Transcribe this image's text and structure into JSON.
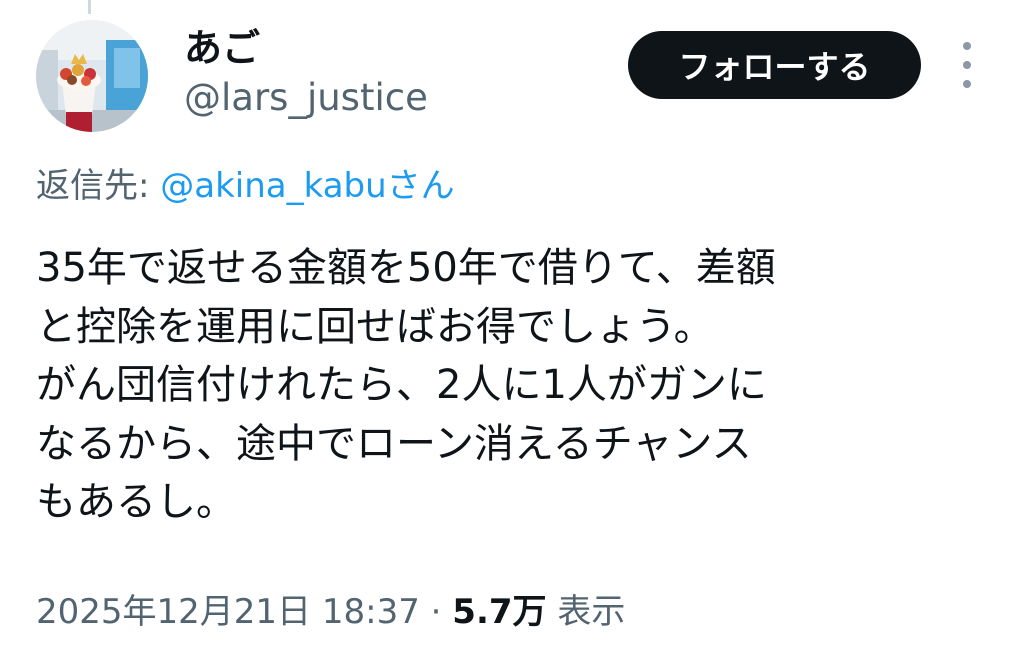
{
  "user": {
    "display_name": "あご",
    "handle": "@lars_justice"
  },
  "follow_button": {
    "label": "フォローする"
  },
  "more_menu": {
    "icon": "more-vertical-icon"
  },
  "reply": {
    "prefix": "返信先: ",
    "mention": "@akina_kabuさん"
  },
  "tweet": {
    "lines": [
      "35年で返せる金額を50年で借りて、差額",
      "と控除を運用に回せばお得でしょう。",
      "がん団信付けれたら、2人に1人がガンに",
      "なるから、途中でローン消えるチャンス",
      "もあるし。"
    ]
  },
  "meta": {
    "timestamp": "2025年12月21日 18:37",
    "separator": "·",
    "views_count": "5.7万",
    "views_label": "表示"
  },
  "colors": {
    "text": "#0f1419",
    "secondary": "#536471",
    "link": "#1d9bf0",
    "button_bg": "#0f1419"
  }
}
